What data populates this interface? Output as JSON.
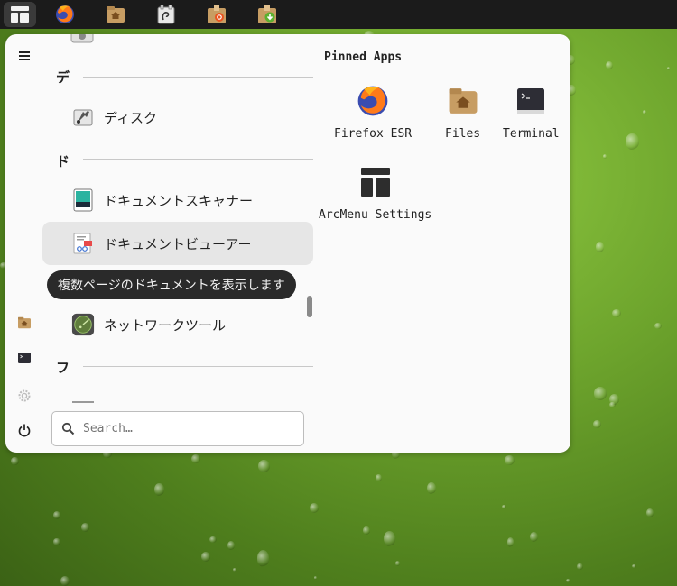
{
  "panel": {
    "apps": [
      {
        "name": "firefox",
        "icon": "firefox-icon"
      },
      {
        "name": "files",
        "icon": "home-folder-icon"
      },
      {
        "name": "gnome-tweaks",
        "icon": "tweaks-icon"
      },
      {
        "name": "software-install",
        "icon": "package-icon"
      },
      {
        "name": "software-update",
        "icon": "download-package-icon"
      }
    ]
  },
  "menu": {
    "sidebar": {
      "items": [
        {
          "icon": "hamburger-icon"
        },
        {
          "icon": "home-folder-icon"
        },
        {
          "icon": "terminal-icon"
        },
        {
          "icon": "settings-gear-icon"
        },
        {
          "icon": "power-icon"
        }
      ]
    },
    "apps": {
      "sections": [
        {
          "header": "デ",
          "items": [
            {
              "label": "ディスク",
              "icon": "disks-icon"
            }
          ]
        },
        {
          "header": "ド",
          "items": [
            {
              "label": "ドキュメントスキャナー",
              "icon": "scanner-icon"
            },
            {
              "label": "ドキュメントビューアー",
              "icon": "document-viewer-icon",
              "hovered": true
            },
            {
              "label": "ネットワークツール",
              "icon": "network-tools-icon"
            }
          ]
        },
        {
          "header": "フ",
          "items": []
        }
      ],
      "tooltip": "複数ページのドキュメントを表示します"
    },
    "search": {
      "placeholder": "Search…"
    },
    "pinned": {
      "title": "Pinned Apps",
      "items": [
        {
          "label": "Firefox ESR",
          "icon": "firefox-icon"
        },
        {
          "label": "Files",
          "icon": "home-folder-icon"
        },
        {
          "label": "Terminal",
          "icon": "terminal-icon"
        },
        {
          "label": "ArcMenu Settings",
          "icon": "arcmenu-settings-icon"
        }
      ]
    }
  },
  "colors": {
    "panel": "#1b1b1b",
    "menu_bg": "#fafafa",
    "hover": "#e6e6e6",
    "tooltip_bg": "#2a2a2a"
  }
}
